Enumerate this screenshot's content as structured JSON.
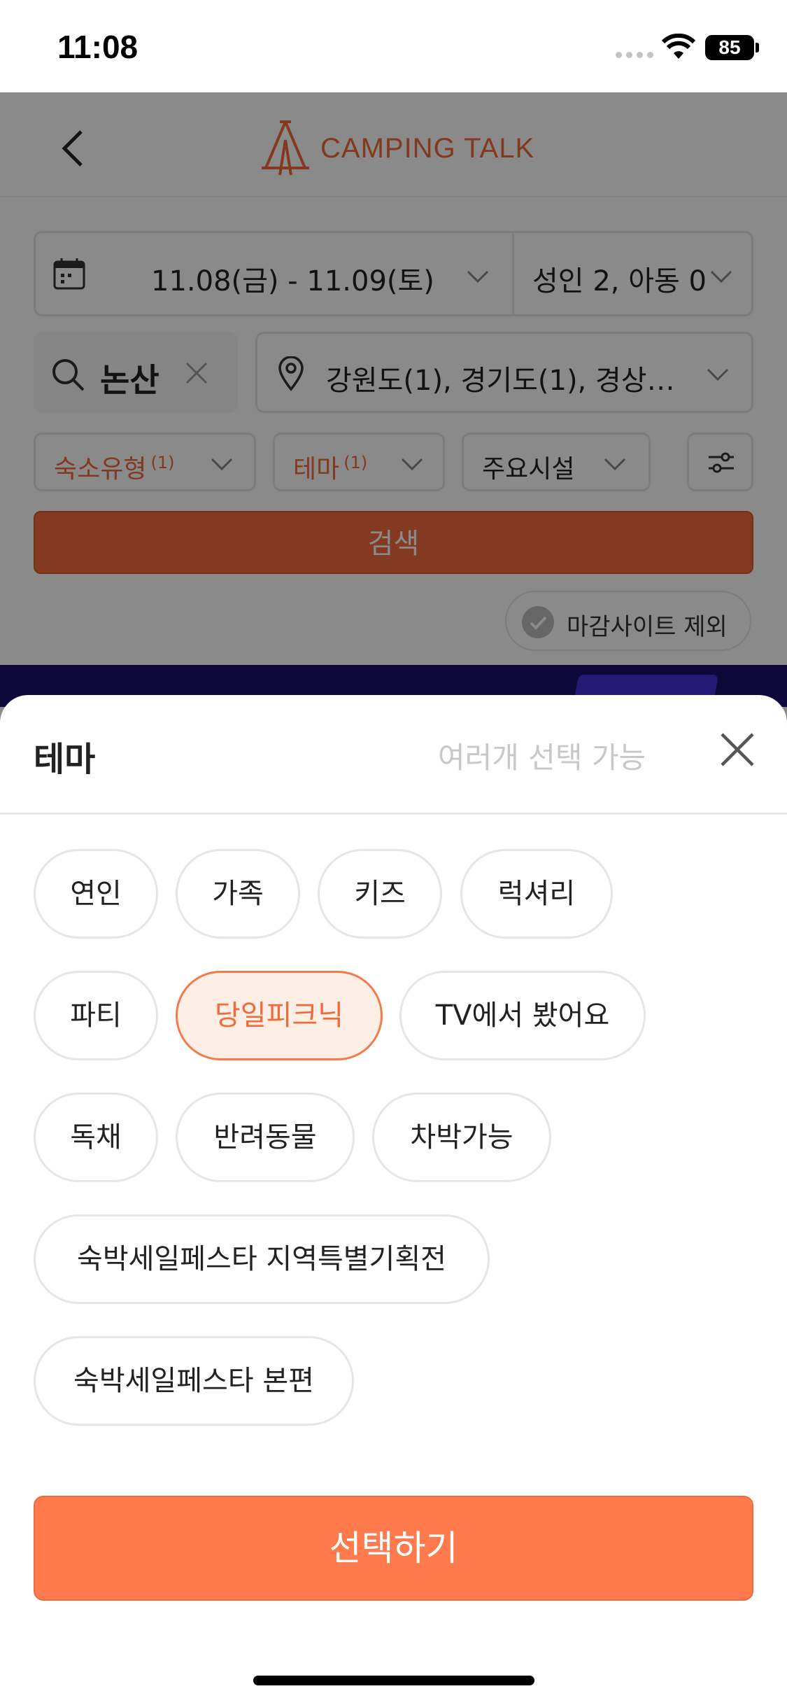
{
  "status_bar": {
    "time": "11:08",
    "battery": "85"
  },
  "header": {
    "logo_text": "CAMPING TALK"
  },
  "search": {
    "date_range": "11.08(금) - 11.09(토)",
    "guests": "성인 2, 아동 0",
    "keyword": "논산",
    "region": "강원도(1), 경기도(1), 경상…",
    "filters": [
      {
        "label": "숙소유형",
        "count": "(1)"
      },
      {
        "label": "테마",
        "count": "(1)"
      },
      {
        "label": "주요시설",
        "count": ""
      }
    ],
    "search_button": "검색",
    "exclude_closed": "마감사이트 제외"
  },
  "sheet": {
    "title": "테마",
    "hint": "여러개 선택 가능",
    "chips": [
      {
        "label": "연인",
        "selected": false
      },
      {
        "label": "가족",
        "selected": false
      },
      {
        "label": "키즈",
        "selected": false
      },
      {
        "label": "럭셔리",
        "selected": false
      },
      {
        "label": "파티",
        "selected": false
      },
      {
        "label": "당일피크닉",
        "selected": true
      },
      {
        "label": "TV에서 봤어요",
        "selected": false
      },
      {
        "label": "독채",
        "selected": false
      },
      {
        "label": "반려동물",
        "selected": false
      },
      {
        "label": "차박가능",
        "selected": false
      },
      {
        "label": "숙박세일페스타 지역특별기획전",
        "selected": false
      },
      {
        "label": "숙박세일페스타 본편",
        "selected": false
      }
    ],
    "select_button": "선택하기"
  },
  "colors": {
    "accent": "#f16a3a",
    "button": "#ff7b4e",
    "selected_bg": "#fdeee6"
  },
  "icons": [
    "back-arrow-icon",
    "tent-logo-icon",
    "calendar-icon",
    "chevron-down-icon",
    "search-icon",
    "clear-icon",
    "location-pin-icon",
    "sliders-icon",
    "check-icon",
    "close-icon"
  ]
}
